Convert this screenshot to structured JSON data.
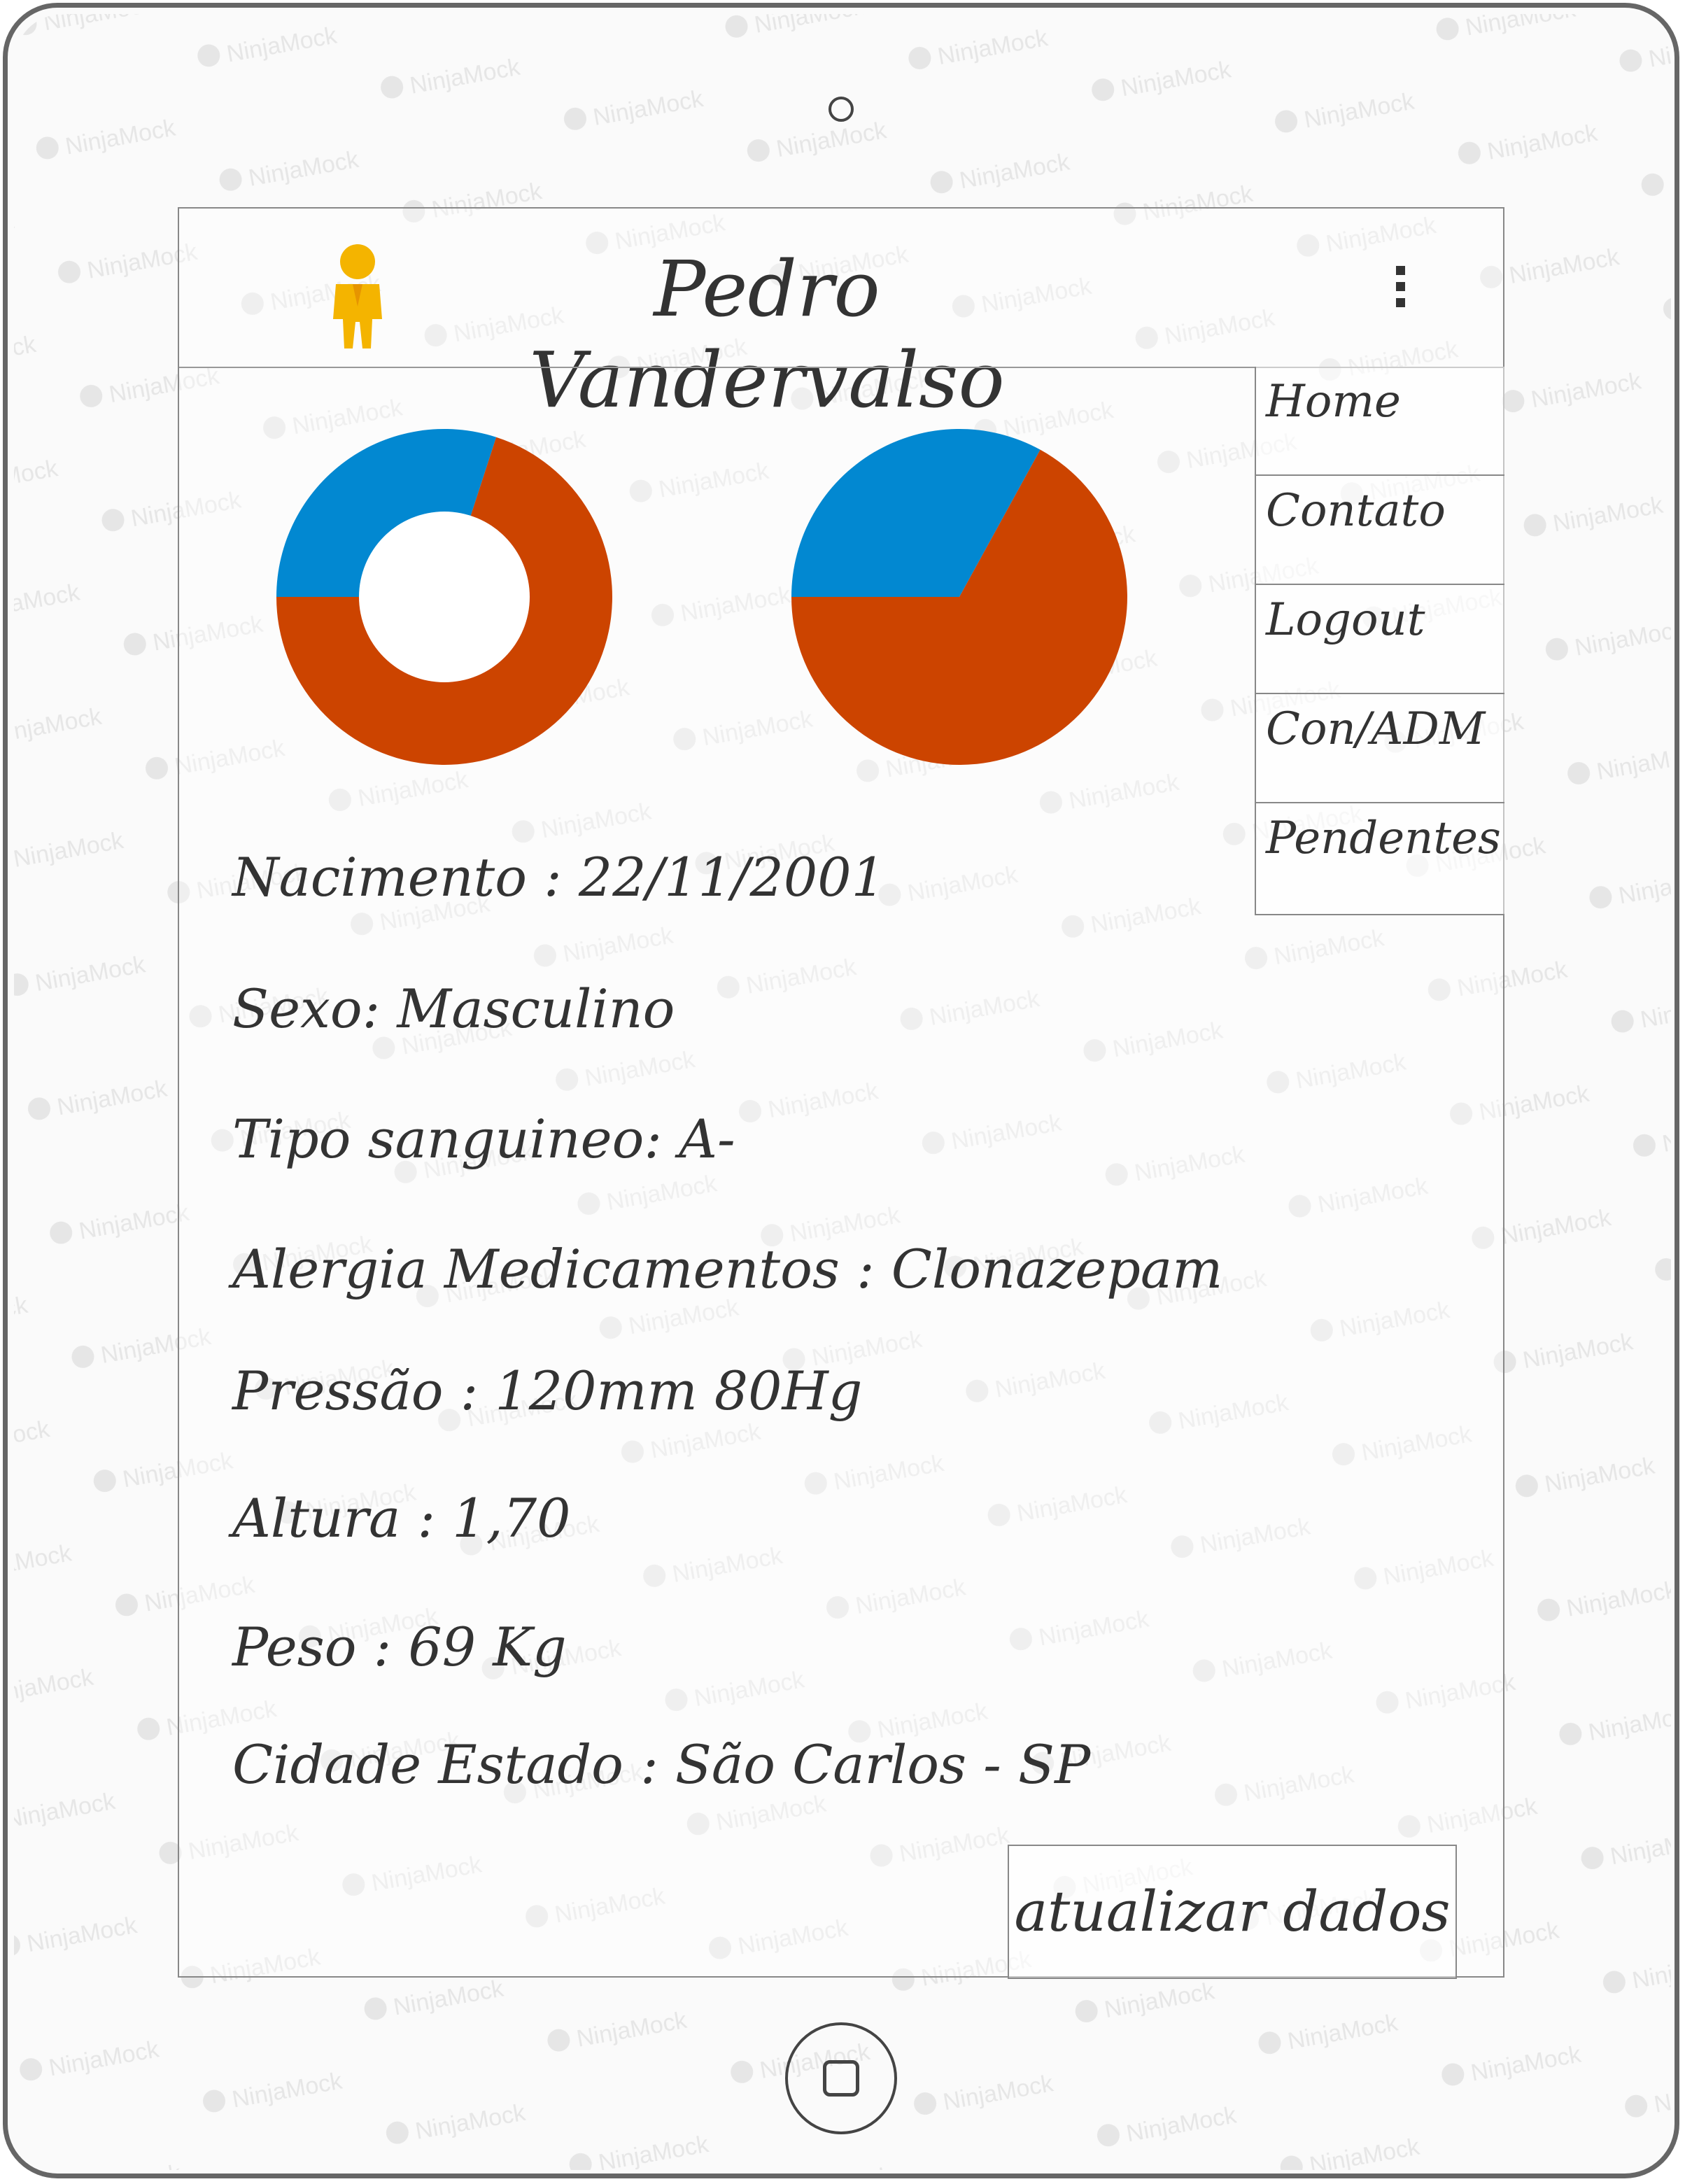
{
  "header": {
    "title": "Pedro Vandervalso",
    "avatar_icon": "person-icon",
    "menu_icon": "kebab-menu-icon"
  },
  "menu": {
    "items": [
      {
        "label": "Home"
      },
      {
        "label": "Contato"
      },
      {
        "label": "Logout"
      },
      {
        "label": "Con/ADM"
      },
      {
        "label": "Pendentes"
      }
    ]
  },
  "colors": {
    "blue": "#0288D1",
    "orange": "#CC4400",
    "avatar": "#F4B400"
  },
  "charts": [
    {
      "type": "donut",
      "slices": [
        {
          "color": "blue",
          "fraction": 0.3
        },
        {
          "color": "orange",
          "fraction": 0.7
        }
      ]
    },
    {
      "type": "pie",
      "slices": [
        {
          "color": "blue",
          "fraction": 0.33
        },
        {
          "color": "orange",
          "fraction": 0.67
        }
      ]
    }
  ],
  "profile": {
    "nascimento": "Nacimento : 22/11/2001",
    "sexo": "Sexo: Masculino",
    "tipo_sanguineo": "Tipo sanguineo: A-",
    "alergia": "Alergia Medicamentos : Clonazepam",
    "pressao": "Pressão : 120mm 80Hg",
    "altura": "Altura : 1,70",
    "peso": "Peso : 69 Kg",
    "cidade_estado": "Cidade Estado : São Carlos - SP"
  },
  "actions": {
    "update_label": "atualizar dados"
  },
  "device": {
    "camera_icon": "camera-icon",
    "home_button_icon": "home-button-icon"
  },
  "watermark": "NinjaMock"
}
